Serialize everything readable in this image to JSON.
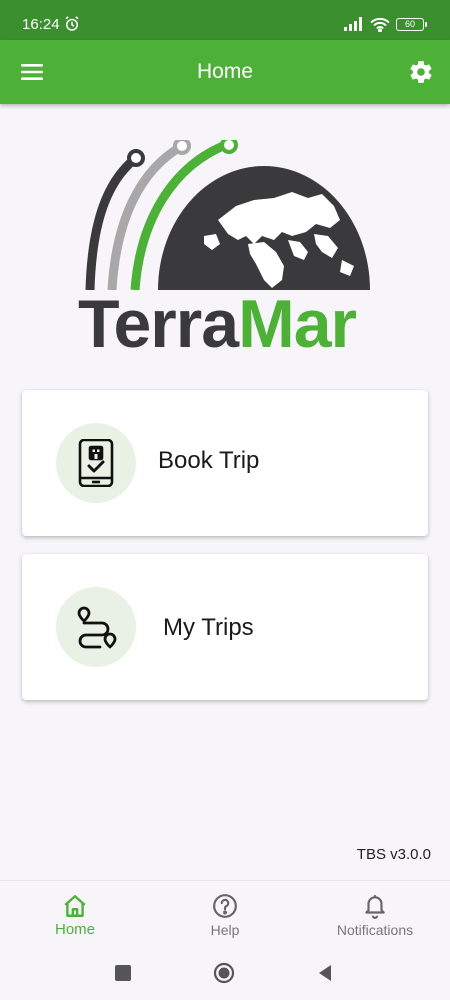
{
  "status_bar": {
    "time": "16:24",
    "battery": "60",
    "icons": [
      "alarm-icon",
      "signal-icon",
      "wifi-icon",
      "battery-icon"
    ]
  },
  "app_bar": {
    "title": "Home",
    "left_icon": "menu-icon",
    "right_icon": "settings-icon",
    "color": "#4db138"
  },
  "logo": {
    "part1": "Terra",
    "part2": "Mar",
    "colors": {
      "dark": "#3a3a3c",
      "green": "#4db138",
      "gray": "#a8a8a8"
    }
  },
  "cards": [
    {
      "label": "Book Trip",
      "icon": "phone-booking-icon"
    },
    {
      "label": "My Trips",
      "icon": "route-icon"
    }
  ],
  "version": "TBS v3.0.0",
  "bottom_nav": {
    "items": [
      {
        "label": "Home",
        "icon": "home-icon",
        "active": true
      },
      {
        "label": "Help",
        "icon": "help-icon",
        "active": false
      },
      {
        "label": "Notifications",
        "icon": "bell-icon",
        "active": false
      }
    ]
  },
  "system_nav": [
    "recents-button",
    "home-button",
    "back-button"
  ]
}
